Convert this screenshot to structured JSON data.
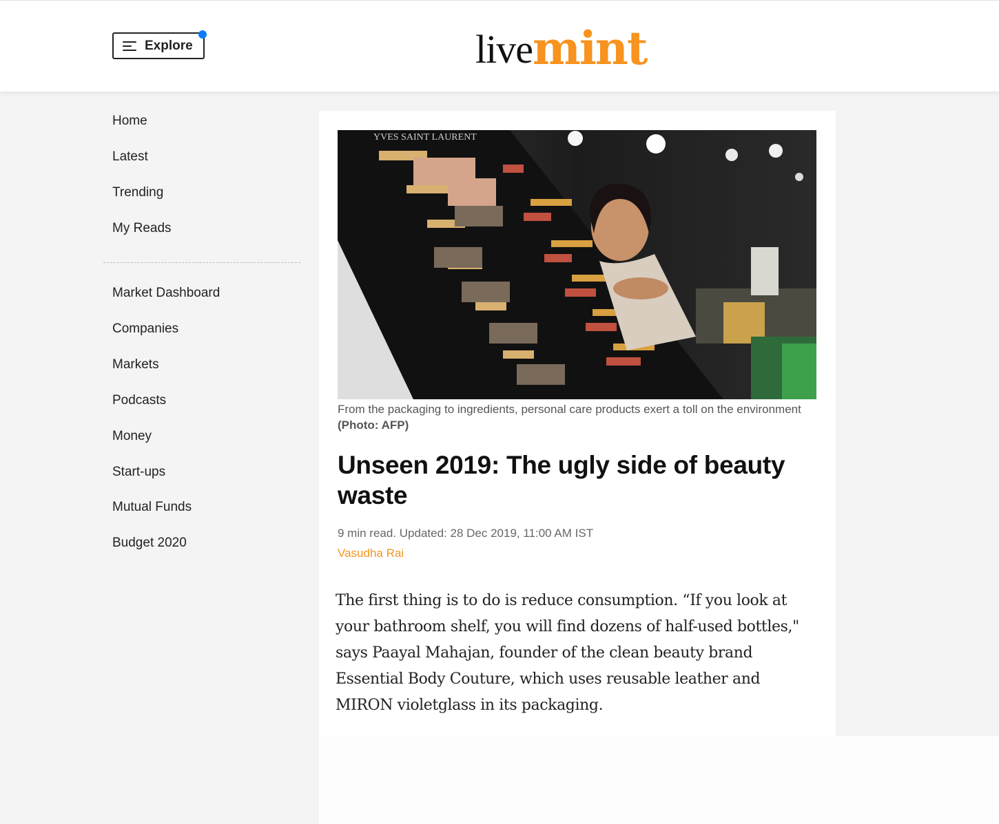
{
  "header": {
    "explore_label": "Explore",
    "logo_live": "live",
    "logo_mint": "mint",
    "brand_color": "#f7931e",
    "notification_color": "#0a7cff"
  },
  "sidebar": {
    "primary_items": [
      {
        "label": "Home"
      },
      {
        "label": "Latest"
      },
      {
        "label": "Trending"
      },
      {
        "label": "My Reads"
      }
    ],
    "section_items": [
      {
        "label": "Market Dashboard"
      },
      {
        "label": "Companies"
      },
      {
        "label": "Markets"
      },
      {
        "label": "Podcasts"
      },
      {
        "label": "Money"
      },
      {
        "label": "Start-ups"
      },
      {
        "label": "Mutual Funds"
      },
      {
        "label": "Budget 2020"
      }
    ]
  },
  "article": {
    "image_caption": "From the packaging to ingredients, personal care products exert a toll on the environment",
    "image_credit": "(Photo: AFP)",
    "headline": "Unseen 2019: The ugly side of beauty waste",
    "read_time": "9 min read",
    "updated": ". Updated: 28 Dec 2019, 11:00 AM IST",
    "author": "Vasudha Rai",
    "body": "The first thing is to do is reduce consumption. “If you look at your bathroom shelf, you will find dozens of half-used bottles,\" says Paayal Mahajan, founder of the clean beauty brand Essential Body Couture, which uses reusable leather and MIRON violetglass in its packaging."
  }
}
